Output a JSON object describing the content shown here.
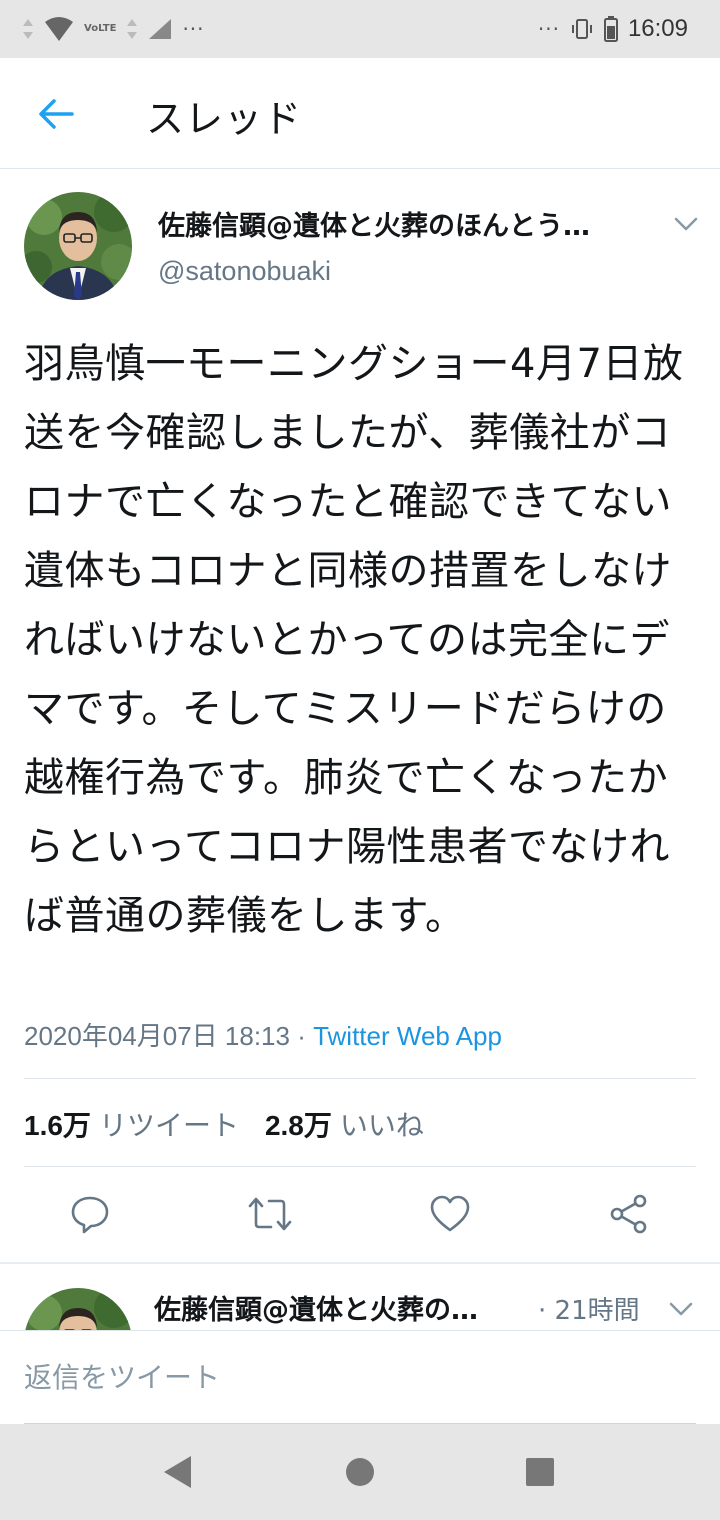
{
  "status_bar": {
    "time": "16:09",
    "left_dots": "···",
    "right_dots": "···",
    "volte_label": "VoLTE"
  },
  "app_bar": {
    "title": "スレッド"
  },
  "tweet": {
    "author_name": "佐藤信顕@遺体と火葬のほんとう…",
    "handle": "@satonobuaki",
    "text": "羽鳥慎一モーニングショー4月7日放送を今確認しましたが、葬儀社がコロナで亡くなったと確認できてない遺体もコロナと同様の措置をしなければいけないとかってのは完全にデマです。そしてミスリードだらけの越権行為です。肺炎で亡くなったからといってコロナ陽性患者でなければ普通の葬儀をします。",
    "timestamp": "2020年04月07日 18:13",
    "separator": " · ",
    "source": "Twitter Web App",
    "retweet_count": "1.6万",
    "retweet_label": "リツイート",
    "like_count": "2.8万",
    "like_label": "いいね"
  },
  "actions": [
    "reply-icon",
    "retweet-icon",
    "like-icon",
    "share-icon"
  ],
  "reply_preview": {
    "author_name": "佐藤信顕@遺体と火葬の…",
    "time": "· 21時間"
  },
  "composer": {
    "placeholder": "返信をツイート"
  },
  "colors": {
    "accent": "#1da1f2",
    "secondary_text": "#657786",
    "status_bar_bg": "#e6e6e6"
  }
}
